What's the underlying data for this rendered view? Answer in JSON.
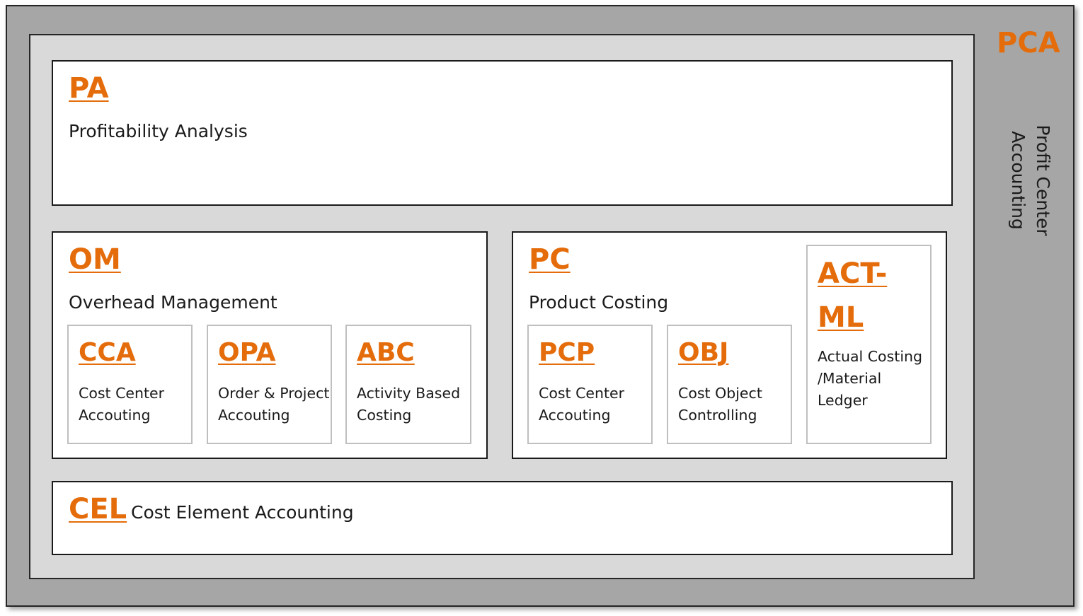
{
  "pca": {
    "code": "PCA",
    "label": "Profit Center Accounting"
  },
  "pa": {
    "code": "PA",
    "label": "Profitability Analysis"
  },
  "om": {
    "code": "OM",
    "label": "Overhead Management",
    "modules": [
      {
        "code": "CCA",
        "line1": "Cost Center",
        "line2": "Accouting"
      },
      {
        "code": "OPA",
        "line1": "Order & Project",
        "line2": "Accouting"
      },
      {
        "code": "ABC",
        "line1": "Activity Based",
        "line2": "Costing"
      }
    ]
  },
  "pc": {
    "code": "PC",
    "label": "Product Costing",
    "modules": [
      {
        "code": "PCP",
        "line1": "Cost Center",
        "line2": "Accouting"
      },
      {
        "code": "OBJ",
        "line1": "Cost Object",
        "line2": "Controlling"
      }
    ],
    "actml": {
      "code1": "ACT-",
      "code2": "ML",
      "line1": "Actual Costing",
      "line2": "/Material",
      "line3": "Ledger"
    }
  },
  "cel": {
    "code": "CEL",
    "label": "Cost Element Accounting"
  },
  "colors": {
    "accent": "#e46c0a",
    "outer_bg": "#a6a6a6",
    "inner_bg": "#d9d9d9",
    "sub_border": "#bfbfbf"
  }
}
